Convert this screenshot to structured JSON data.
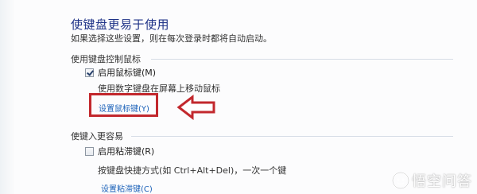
{
  "header": {
    "title": "使键盘更易于使用",
    "subtitle": "如果选择这些设置，则在每次登录时都将自动启动。"
  },
  "sections": [
    {
      "header": "使用键盘控制鼠标",
      "checkbox_label": "启用鼠标键(M)",
      "checked": true,
      "description": "使用数字键盘在屏幕上移动鼠标",
      "link": "设置鼠标键(Y)"
    },
    {
      "header": "使键入更容易",
      "checkbox_label": "启用粘滞键(R)",
      "checked": false,
      "description": "按键盘快捷方式(如 Ctrl+Alt+Del)，一次一个键",
      "link": "设置粘滞键(C)"
    }
  ],
  "annotation": {
    "highlight_color": "#c2282d",
    "arrow_icon": "left-arrow-outline-icon"
  },
  "watermark": {
    "text": "悟空问答",
    "icon": "wukong-logo-icon"
  }
}
